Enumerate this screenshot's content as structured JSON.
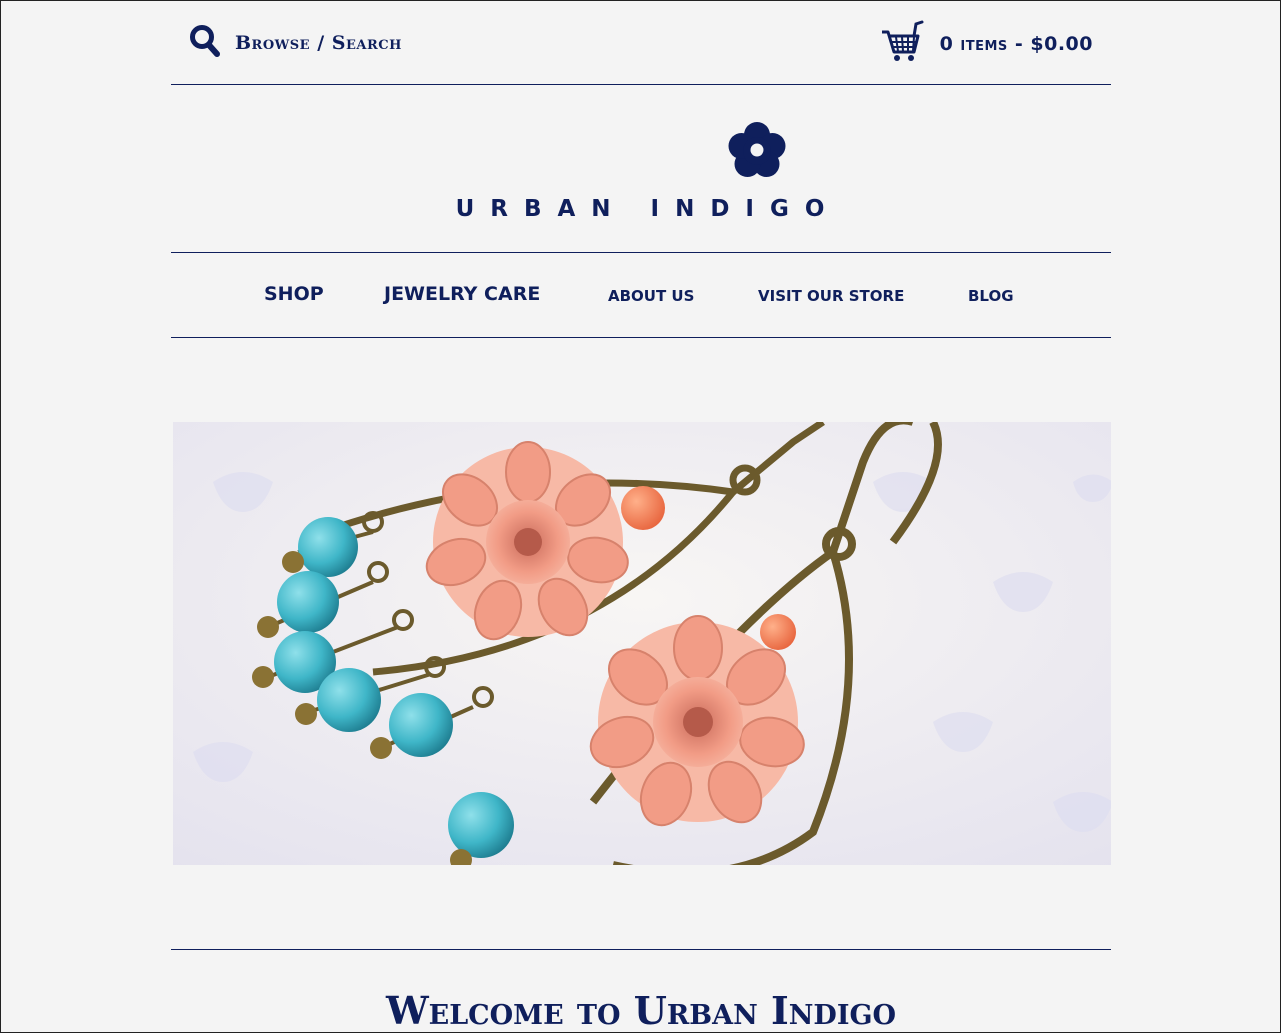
{
  "header": {
    "browse_label": "Browse / Search",
    "cart_label": "0 items - $0.00"
  },
  "logo": {
    "text": "URBAN INDIGO"
  },
  "nav": {
    "items": [
      {
        "label": "SHOP"
      },
      {
        "label": "JEWELRY CARE"
      },
      {
        "label": "ABOUT US"
      },
      {
        "label": "VISIT OUR STORE"
      },
      {
        "label": "BLOG"
      }
    ]
  },
  "hero": {
    "subject": "photo of peach flower and turquoise bead chandelier earrings"
  },
  "main": {
    "welcome_title": "Welcome to Urban Indigo"
  },
  "colors": {
    "brand": "#0f1f5c",
    "background": "#f4f4f4"
  },
  "icons": {
    "search": "search-icon",
    "cart": "cart-icon",
    "flower": "flower-logo-icon"
  }
}
